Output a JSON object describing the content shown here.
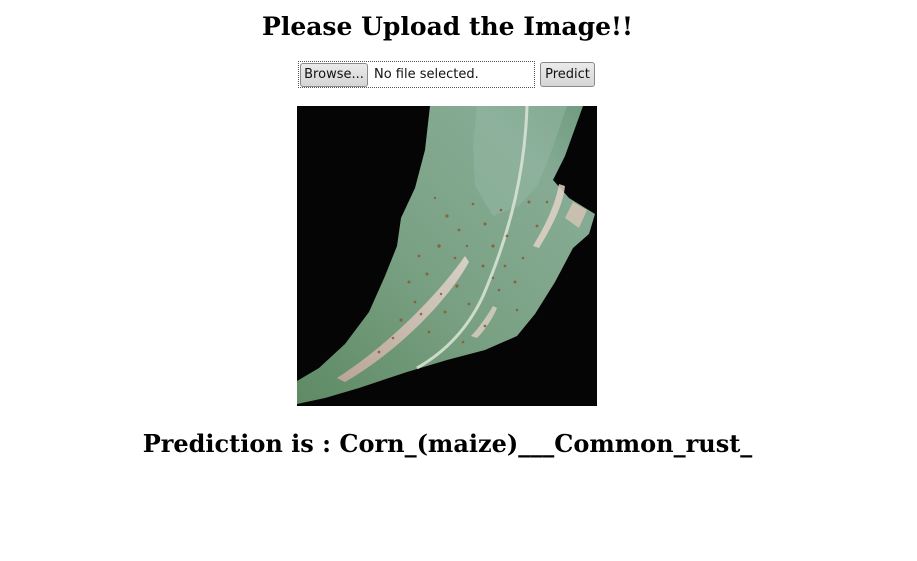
{
  "page": {
    "title": "Please Upload the Image!!"
  },
  "upload_form": {
    "browse_label": "Browse...",
    "file_status": "No file selected.",
    "predict_label": "Predict"
  },
  "preview": {
    "alt": "leaf-image"
  },
  "result": {
    "text": "Prediction is : Corn_(maize)___Common_rust_"
  },
  "colors": {
    "background": "#ffffff",
    "image_background": "#050505",
    "leaf_green": "#6f9a7a",
    "rust_spots": "#8a5a30"
  }
}
